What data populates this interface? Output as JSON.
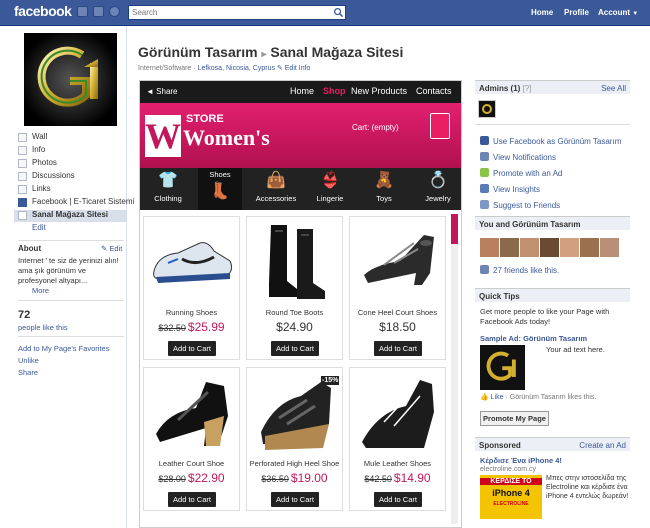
{
  "topbar": {
    "logo": "facebook",
    "search_placeholder": "Search",
    "nav": [
      "Home",
      "Profile",
      "Account"
    ],
    "account_arrow": "▼",
    "bg_color": "#3b5998"
  },
  "left": {
    "nav": [
      {
        "icon": "wall-icon",
        "label": "Wall"
      },
      {
        "icon": "info-icon",
        "label": "Info"
      },
      {
        "icon": "photos-icon",
        "label": "Photos"
      },
      {
        "icon": "discussions-icon",
        "label": "Discussions"
      },
      {
        "icon": "links-icon",
        "label": "Links"
      },
      {
        "icon": "facebook-icon",
        "label": "Facebook | E-Ticaret Sistemi"
      },
      {
        "icon": "star-icon",
        "label": "Sanal Mağaza Sitesi"
      }
    ],
    "edit_label": "Edit",
    "about_heading": "About",
    "about_edit": "Edit",
    "about_text": "Internet ' te siz de yerinizi alın! ama şık görünüm ve profesyonel altyapı...",
    "more_label": "More",
    "likes_count": "72",
    "likes_label": "people like this",
    "add_fav": "Add to My Page's Favorites",
    "unlike": "Unlike",
    "share": "Share"
  },
  "page": {
    "title_main": "Görünüm Tasarım",
    "title_arrow": "▸",
    "title_tab": "Sanal Mağaza Sitesi",
    "category": "Internet/Software",
    "separator": "·",
    "location": "Lefkosa, Nicosia, Cyprus",
    "edit_info": "Edit Info"
  },
  "shop": {
    "share_label": "Share",
    "nav": [
      {
        "label": "Home",
        "active": false
      },
      {
        "label": "Shop",
        "active": true
      },
      {
        "label": "New Products",
        "active": false
      },
      {
        "label": "Contacts",
        "active": false
      }
    ],
    "banner_store": "STORE",
    "banner_title": "Women's",
    "cart_label": "Cart:",
    "cart_value": "(empty)",
    "categories": [
      {
        "label": "Clothing",
        "glyph": "👕"
      },
      {
        "label": "Shoes",
        "glyph": "👢"
      },
      {
        "label": "Accessories",
        "glyph": "👜"
      },
      {
        "label": "Lingerie",
        "glyph": "👙"
      },
      {
        "label": "Toys",
        "glyph": "🧸"
      },
      {
        "label": "Jewelry",
        "glyph": "💍"
      }
    ],
    "accent": "#c2185b",
    "products": [
      {
        "name": "Running Shoes",
        "old_price": "$32.50",
        "price": "$25.99",
        "button": "Add to Cart"
      },
      {
        "name": "Round Toe Boots",
        "old_price": "",
        "price": "$24.90",
        "button": "Add to Cart"
      },
      {
        "name": "Cone Heel Court Shoes",
        "old_price": "",
        "price": "$18.50",
        "button": "Add to Cart"
      },
      {
        "name": "Leather Court Shoe",
        "old_price": "$28.00",
        "price": "$22.90",
        "button": "Add to Cart"
      },
      {
        "name": "Perforated High Heel Shoe",
        "old_price": "$36.50",
        "price": "$19.00",
        "button": "Add to Cart"
      },
      {
        "name": "Mule Leather Shoes",
        "old_price": "$42.50",
        "price": "$14.90",
        "button": "Add to Cart"
      }
    ],
    "badge": "-15%"
  },
  "right": {
    "admins_heading": "Admins (1)",
    "admins_help": "[?]",
    "see_all": "See All",
    "admin_links": [
      "Use Facebook as Görünüm Tasarım",
      "View Notifications",
      "Promote with an Ad",
      "View Insights",
      "Suggest to Friends"
    ],
    "friends_heading": "You and Görünüm Tasarım",
    "friends_like": "27 friends like this.",
    "quick_tips_heading": "Quick Tips",
    "quick_tips_text": "Get more people to like your Page with Facebook Ads today!",
    "sample_ad_title": "Sample Ad: Görünüm Tasarım",
    "sample_ad_text": "Your ad text here.",
    "like_label": "Like",
    "like_text": "· Görünüm Tasarım likes this.",
    "promote_button": "Promote My Page",
    "sponsored_heading": "Sponsored",
    "create_ad": "Create an Ad",
    "ad_title": "Κέρδισε Ένα iPhone 4!",
    "ad_domain": "electroline.com.cy",
    "ad_image_text1": "ΚΕΡΔΙΣΕ ΤΟ",
    "ad_image_text2": "iPhone 4",
    "ad_image_text3": "ELECTROLINE",
    "ad_body": "Μπες στην ιστοσελίδα της Electroline και κέρδισε ένα iPhone 4 εντελώς δωρεάν!"
  }
}
